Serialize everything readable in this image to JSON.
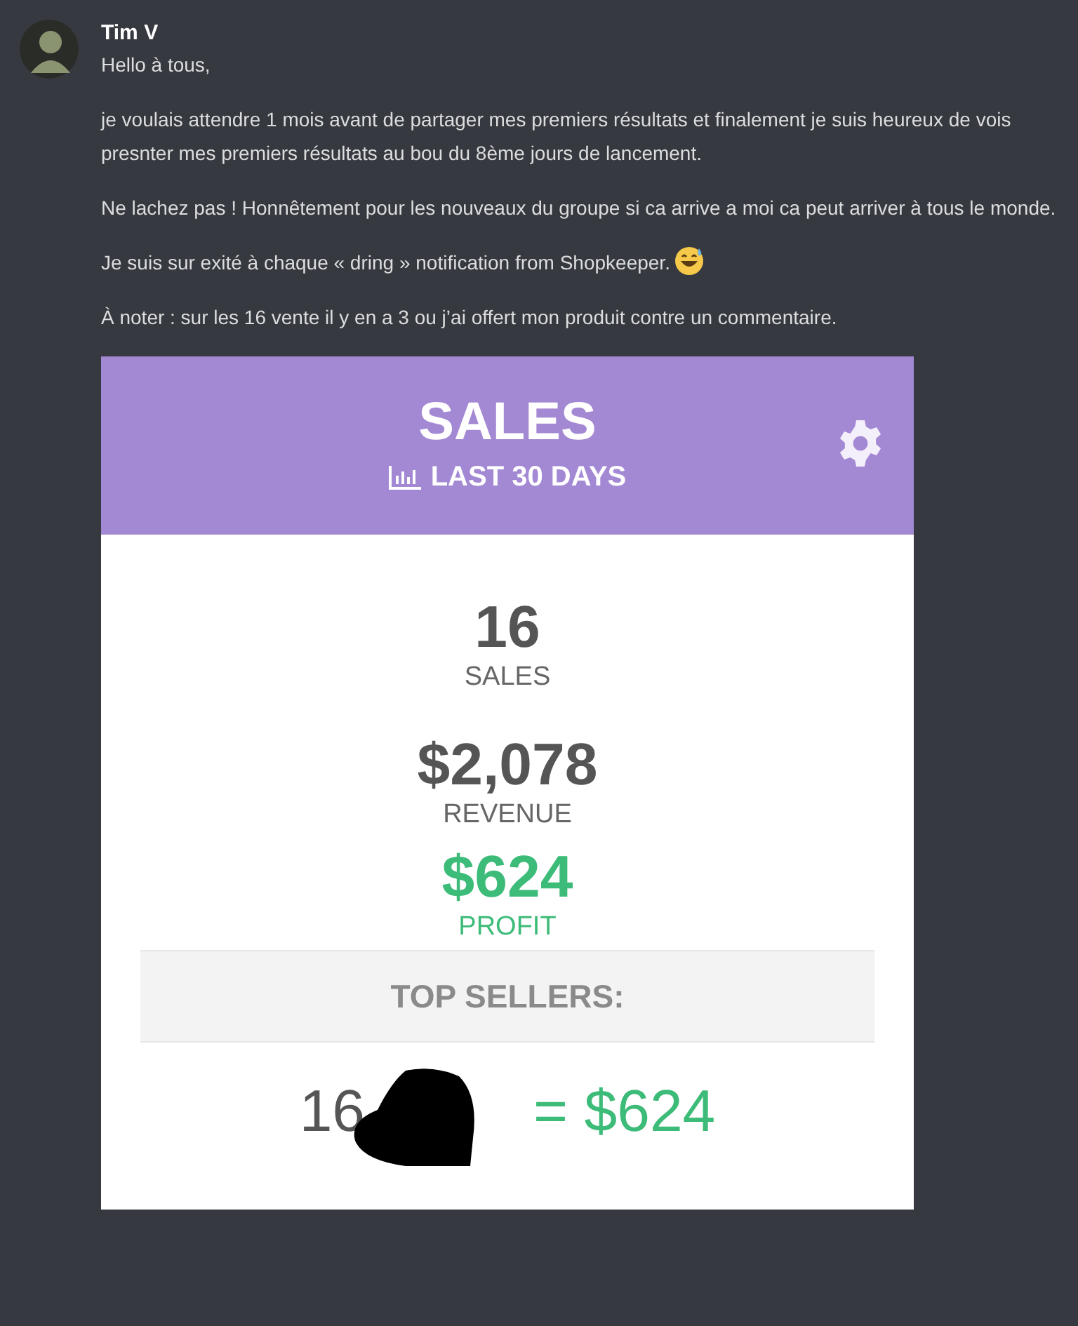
{
  "author": {
    "name": "Tim V"
  },
  "message": {
    "paragraphs": [
      {
        "text": "Hello à tous,",
        "emoji": false
      },
      {
        "text": "je voulais attendre 1 mois avant de partager mes premiers résultats et finalement je suis heureux de vois presnter mes premiers résultats au bou du 8ème jours de lancement.",
        "emoji": false
      },
      {
        "text": "Ne lachez pas ! Honnêtement pour les nouveaux du groupe si ca arrive a moi ca peut arriver à tous le monde.",
        "emoji": false
      },
      {
        "text": "Je suis sur exité à chaque « dring » notification from Shopkeeper.",
        "emoji": true
      },
      {
        "text": "À noter : sur les 16 vente il y en a 3 ou j’ai offert mon produit contre un commentaire.",
        "emoji": false
      }
    ]
  },
  "card": {
    "title": "SALES",
    "period": "LAST 30 DAYS",
    "stats": [
      {
        "value": "16",
        "label": "SALES",
        "kind": "neutral"
      },
      {
        "value": "$2,078",
        "label": "REVENUE",
        "kind": "neutral"
      },
      {
        "value": "$624",
        "label": "PROFIT",
        "kind": "profit"
      }
    ],
    "top_sellers": {
      "heading": "TOP SELLERS:",
      "rows": [
        {
          "quantity": "16",
          "total": "= $624",
          "redacted": true
        }
      ]
    }
  }
}
